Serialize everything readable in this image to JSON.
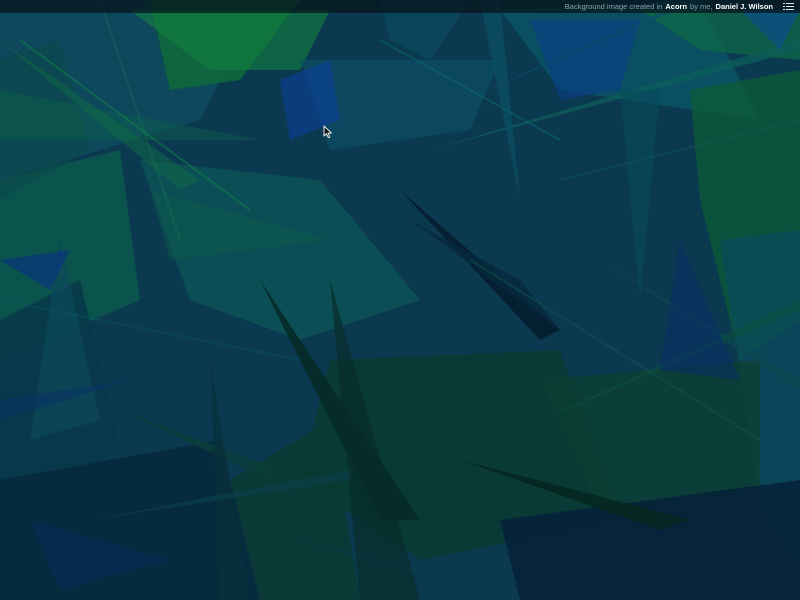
{
  "credit": {
    "prefix": "Background image created in",
    "app_name": "Acorn",
    "middle": "by me,",
    "author": "Daniel J. Wilson"
  },
  "icons": {
    "menu": "list-menu-icon",
    "cursor": "mouse-pointer-icon"
  },
  "colors": {
    "background_base": "#0b3b52",
    "green_accent": "#0f6b3a",
    "blue_accent": "#0a4a8c",
    "topbar": "#06141a"
  }
}
